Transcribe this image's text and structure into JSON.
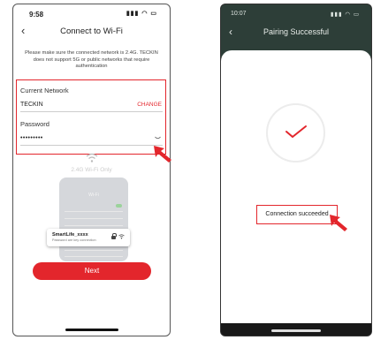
{
  "left_screen": {
    "status_time": "9:58",
    "status_icons": "signal wifi battery",
    "title": "Connect to Wi-Fi",
    "notice": "Please make sure the connected network is 2.4G. TECKIN does not support 5G or public networks that require authentication",
    "current_network_label": "Current Network",
    "current_network_value": "TECKIN",
    "change_label": "CHANGE",
    "password_label": "Password",
    "password_value": "•••••••••",
    "band_note": "2.4G Wi-Fi Only",
    "mock_title": "Wi-Fi",
    "popup_ssid": "SmartLife_xxxx",
    "popup_sub": "Password are key connection",
    "next_label": "Next"
  },
  "right_screen": {
    "status_time": "10:07",
    "title": "Pairing Successful",
    "success_text": "Connection succeeded"
  },
  "colors": {
    "accent_red": "#e3262c",
    "header_dark_green": "#2d3e38"
  },
  "icons": {
    "back": "chevron-left-icon",
    "wifi": "wifi-icon",
    "check": "checkmark-icon",
    "arrow": "pointer-arrow-icon"
  }
}
